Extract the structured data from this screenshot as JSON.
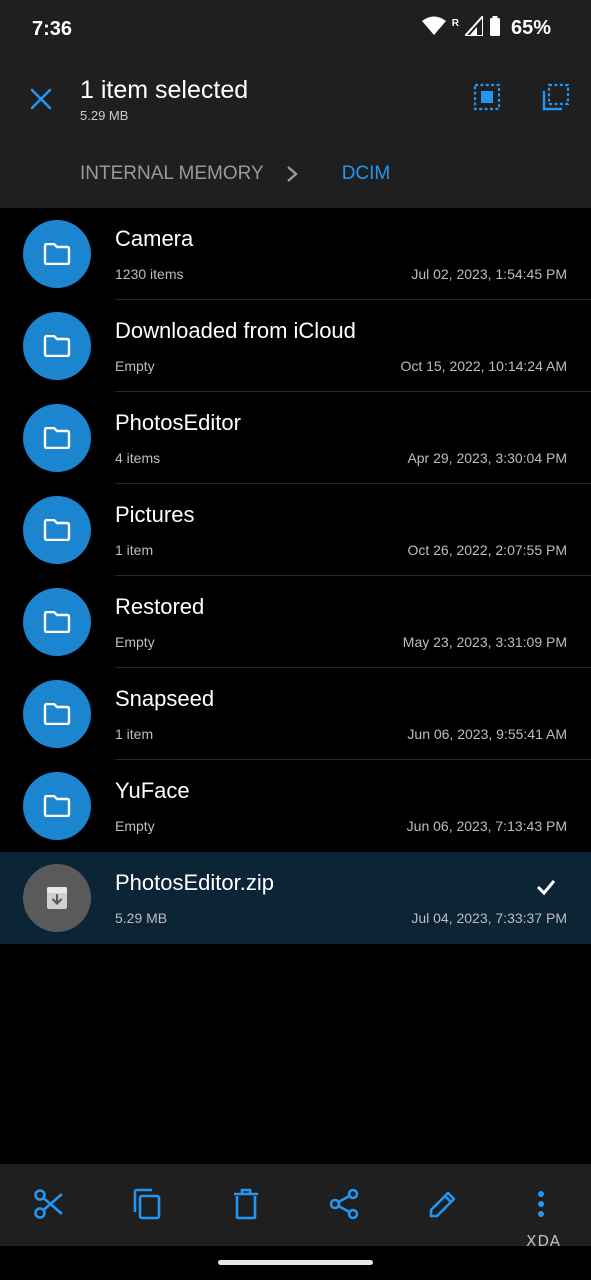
{
  "status_bar": {
    "time": "7:36",
    "roaming_indicator": "R",
    "battery_percent": "65%",
    "icons": [
      "wifi-icon",
      "signal-icon",
      "battery-icon"
    ]
  },
  "selection_bar": {
    "title": "1 item selected",
    "size": "5.29 MB",
    "actions": [
      "select-all-icon",
      "select-range-icon"
    ]
  },
  "breadcrumb": {
    "items": [
      "INTERNAL MEMORY",
      "DCIM"
    ],
    "active_index": 1
  },
  "files": [
    {
      "name": "Camera",
      "meta": "1230 items",
      "date": "Jul 02, 2023, 1:54:45 PM",
      "icon": "folder-icon",
      "selected": false
    },
    {
      "name": "Downloaded from iCloud",
      "meta": "Empty",
      "date": "Oct 15, 2022, 10:14:24 AM",
      "icon": "folder-icon",
      "selected": false
    },
    {
      "name": "PhotosEditor",
      "meta": "4 items",
      "date": "Apr 29, 2023, 3:30:04 PM",
      "icon": "folder-icon",
      "selected": false
    },
    {
      "name": "Pictures",
      "meta": "1 item",
      "date": "Oct 26, 2022, 2:07:55 PM",
      "icon": "folder-icon",
      "selected": false
    },
    {
      "name": "Restored",
      "meta": "Empty",
      "date": "May 23, 2023, 3:31:09 PM",
      "icon": "folder-icon",
      "selected": false
    },
    {
      "name": "Snapseed",
      "meta": "1 item",
      "date": "Jun 06, 2023, 9:55:41 AM",
      "icon": "folder-icon",
      "selected": false
    },
    {
      "name": "YuFace",
      "meta": "Empty",
      "date": "Jun 06, 2023, 7:13:43 PM",
      "icon": "folder-icon",
      "selected": false
    },
    {
      "name": "PhotosEditor.zip",
      "meta": "5.29 MB",
      "date": "Jul 04, 2023, 7:33:37 PM",
      "icon": "archive-icon",
      "selected": true
    }
  ],
  "bottom_actions": [
    "cut-icon",
    "copy-icon",
    "delete-icon",
    "share-icon",
    "rename-icon",
    "more-icon"
  ],
  "watermark": "XDA",
  "colors": {
    "accent": "#2196f3",
    "folder_circle": "#1b85cf",
    "bar_background": "#1f1f1f",
    "selected_row": "#0b2436"
  }
}
